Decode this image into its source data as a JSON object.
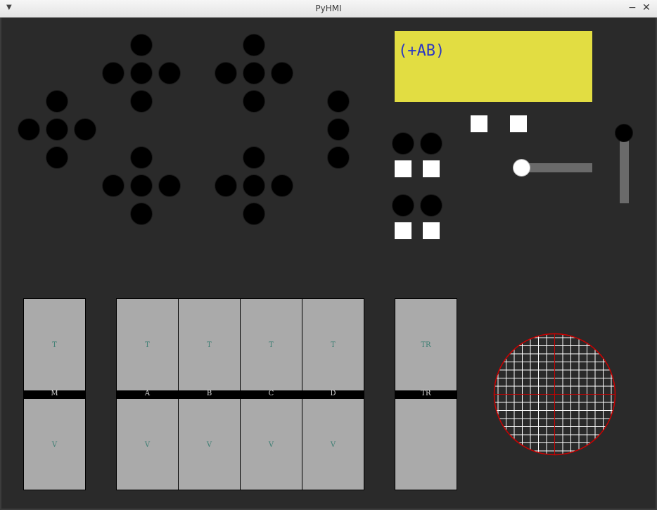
{
  "window": {
    "title": "PyHMI",
    "menu_icon": "chevron-down-icon",
    "minimize_label": "−",
    "close_label": "✕"
  },
  "lcd": {
    "text": "(+AB)",
    "background": "#e2dd42",
    "text_color": "#2b37c4"
  },
  "panels": [
    {
      "id": "M",
      "top": "T",
      "mid": "M",
      "bottom": "V"
    },
    {
      "id": "A",
      "top": "T",
      "mid": "A",
      "bottom": "V"
    },
    {
      "id": "B",
      "top": "T",
      "mid": "B",
      "bottom": "V"
    },
    {
      "id": "C",
      "top": "T",
      "mid": "C",
      "bottom": "V"
    },
    {
      "id": "D",
      "top": "T",
      "mid": "D",
      "bottom": "V"
    },
    {
      "id": "TR",
      "top": "TR",
      "mid": "TR",
      "bottom": ""
    }
  ],
  "colors": {
    "background": "#2a2a2a",
    "panel": "#aaaaaa",
    "label": "#3f7f74",
    "grid_line": "#ffffff",
    "grid_accent": "#cc0000"
  }
}
